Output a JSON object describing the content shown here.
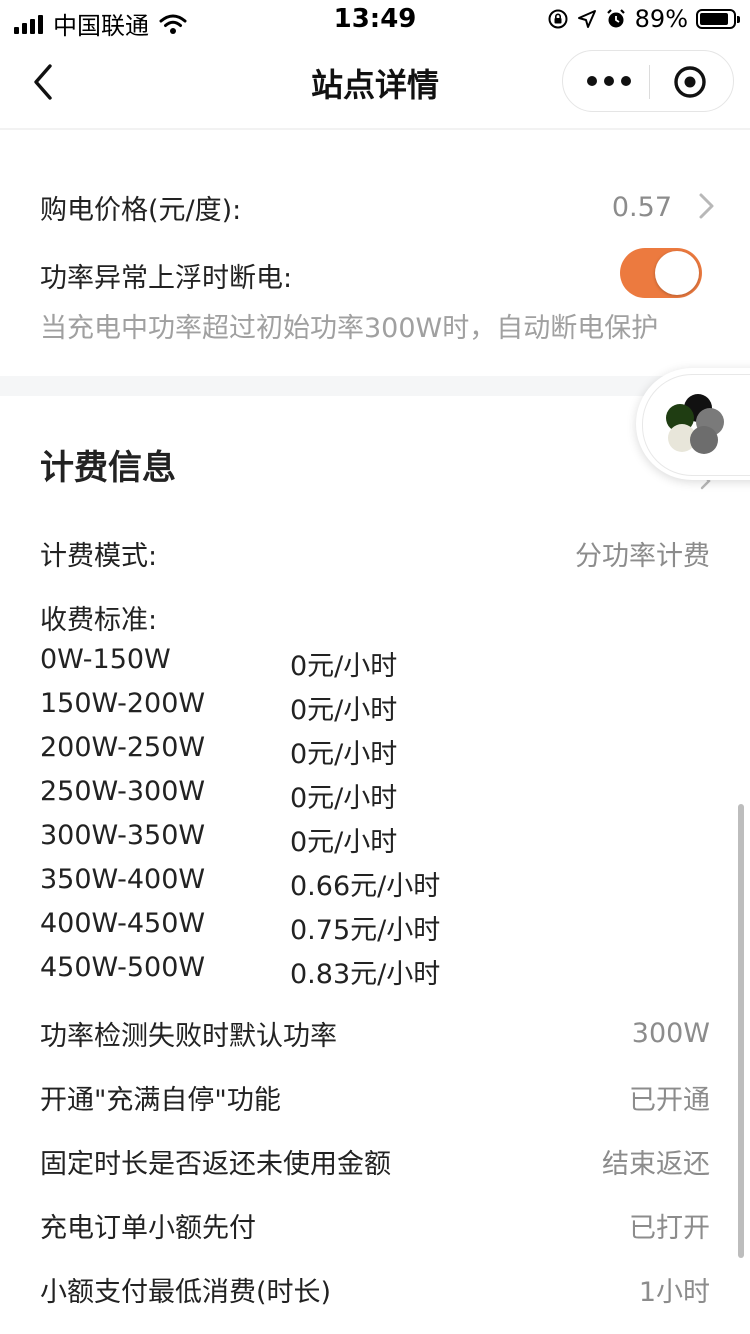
{
  "status_bar": {
    "carrier": "中国联通",
    "time": "13:49",
    "battery_percent": "89%",
    "battery_level": 0.89,
    "icons": [
      "signal-icon",
      "wifi-icon",
      "orientation-lock-icon",
      "location-icon",
      "alarm-icon",
      "battery-icon"
    ]
  },
  "nav": {
    "title": "站点详情",
    "back_icon": "chevron-left-icon",
    "more_icon": "more-dots-icon",
    "close_icon": "target-close-icon"
  },
  "settings": {
    "price_label": "购电价格(元/度):",
    "price_value": "0.57",
    "power_cutoff_label": "功率异常上浮时断电:",
    "power_cutoff_enabled": true,
    "power_cutoff_desc": "当充电中功率超过初始功率300W时，自动断电保护"
  },
  "billing": {
    "title": "计费信息",
    "mode_label": "计费模式:",
    "mode_value": "分功率计费",
    "standard_label": "收费标准:",
    "tiers": [
      {
        "range": "0W-150W",
        "price": "0元/小时"
      },
      {
        "range": "150W-200W",
        "price": "0元/小时"
      },
      {
        "range": "200W-250W",
        "price": "0元/小时"
      },
      {
        "range": "250W-300W",
        "price": "0元/小时"
      },
      {
        "range": "300W-350W",
        "price": "0元/小时"
      },
      {
        "range": "350W-400W",
        "price": "0.66元/小时"
      },
      {
        "range": "400W-450W",
        "price": "0.75元/小时"
      },
      {
        "range": "450W-500W",
        "price": "0.83元/小时"
      }
    ],
    "default_power_label": "功率检测失败时默认功率",
    "default_power_value": "300W",
    "auto_stop_label": "开通\"充满自停\"功能",
    "auto_stop_value": "已开通",
    "refund_label": "固定时长是否返还未使用金额",
    "refund_value": "结束返还",
    "prepay_label": "充电订单小额先付",
    "prepay_value": "已打开",
    "min_consumption_label": "小额支付最低消费(时长)",
    "min_consumption_value": "1小时"
  },
  "colors": {
    "accent": "#ec7a3f",
    "text_primary": "#222222",
    "text_secondary": "#8c8c8c",
    "section_bg": "#f5f6f7"
  }
}
